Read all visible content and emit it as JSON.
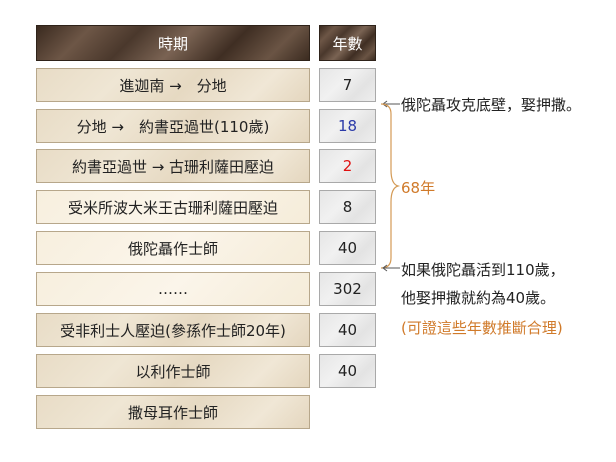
{
  "header": {
    "period": "時期",
    "years": "年數"
  },
  "rows": [
    {
      "period": "進迦南 →　分地",
      "years": "7",
      "years_color": "#222222"
    },
    {
      "period": "分地 →　約書亞過世(110歲)",
      "years": "18",
      "years_color": "#2b3aa8"
    },
    {
      "period": "約書亞過世 → 古珊利薩田壓迫",
      "years": "2",
      "years_color": "#e01010"
    },
    {
      "period": "受米所波大米王古珊利薩田壓迫",
      "years": "8",
      "years_color": "#222222"
    },
    {
      "period": "俄陀聶作士師",
      "years": "40",
      "years_color": "#222222"
    },
    {
      "period": "……",
      "years": "302",
      "years_color": "#222222"
    },
    {
      "period": "受非利士人壓迫(參孫作士師20年)",
      "years": "40",
      "years_color": "#222222"
    },
    {
      "period": "以利作士師",
      "years": "40",
      "years_color": "#222222"
    },
    {
      "period": "撒母耳作士師",
      "years": "",
      "years_color": "#222222"
    }
  ],
  "annotations": {
    "top": "俄陀聶攻克底壁，娶押撒。",
    "brace": "68年",
    "bottom_line1": "如果俄陀聶活到110歲，",
    "bottom_line2": "他娶押撒就約為40歲。",
    "bottom_line3": "(可證這些年數推斷合理)"
  }
}
